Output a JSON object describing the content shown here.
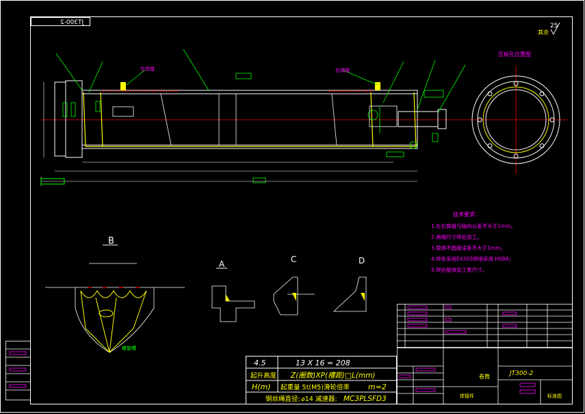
{
  "drawing": {
    "code_mirrored": "JT300-2",
    "surface_mark": "25",
    "surface_mark_note": "其余",
    "labels": {
      "pressplate_view": "压板孔位置图",
      "left_weld": "左焊缝",
      "right_weld": "右焊缝",
      "helix_groove": "螺旋槽"
    },
    "section_letters": {
      "b": "B",
      "a": "A",
      "c": "C",
      "d": "D"
    }
  },
  "tech_req": {
    "title": "技术要求：",
    "items": [
      "1.左右筒盘与轴向公差不大于1mm。",
      "2.两端尺寸焊后加工。",
      "3.筒体不圆度误差不大于1mm。",
      "4.焊条采用E4303焊接采用  H08A；",
      "5.焊后整体加工表尺寸。"
    ]
  },
  "spec_table": {
    "r1": {
      "c1": "4.5",
      "c2": "13   X   16  =  208"
    },
    "r2": {
      "c1": "起升高度",
      "c2": "Z(圈数)XP(槽距)□L(mm)"
    },
    "r3": {
      "c1": "H(m)",
      "c2": "起重量   5t(M5)滑轮倍率",
      "c3": "m=2"
    },
    "r4": {
      "c1": "钢丝绳直径:",
      "c2": "⌀14 减速器:",
      "c3": "MC3PLSFD3"
    }
  },
  "title_block": {
    "name": "卷筒",
    "code": "JT300-2",
    "company": "焊接件",
    "scale_label": "标准图"
  },
  "colors": {
    "outline": "#ffffff",
    "cad_green": "#00ff00",
    "cad_magenta": "#ff00ff",
    "cad_cyan": "#00ffff",
    "cad_yellow": "#ffff00",
    "cad_red": "#ff0000"
  }
}
